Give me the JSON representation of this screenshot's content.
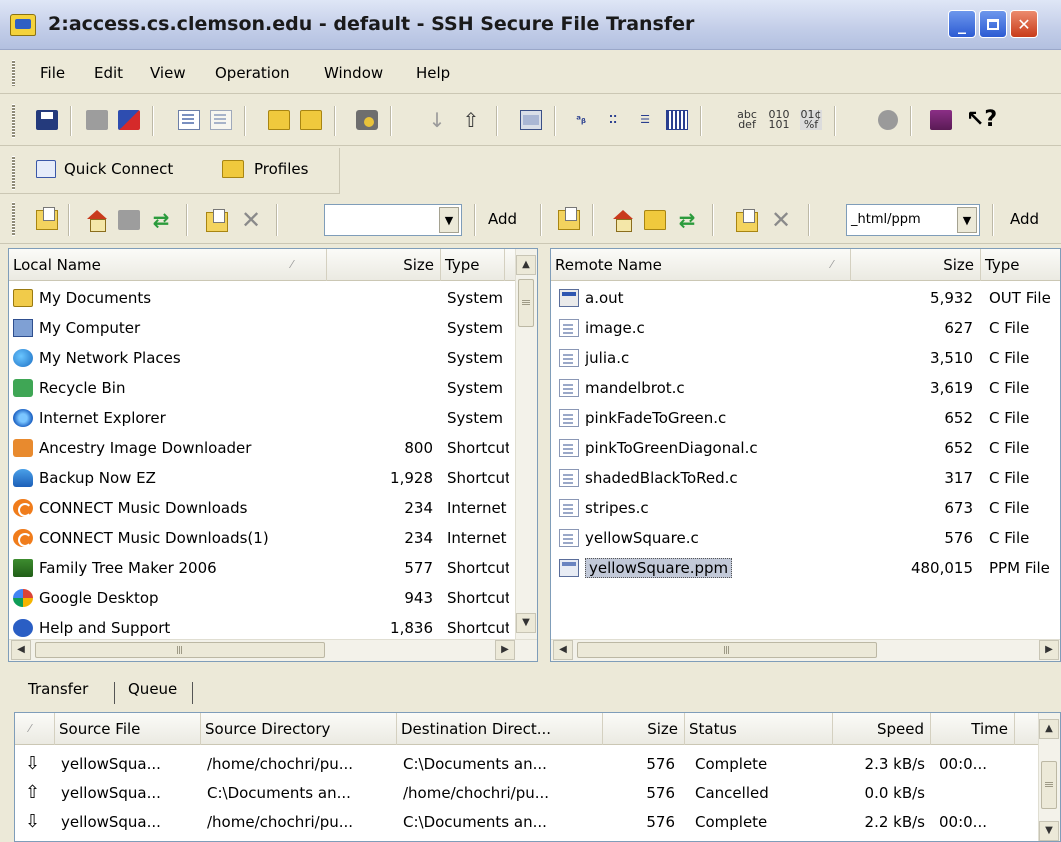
{
  "window": {
    "title": "2:access.cs.clemson.edu - default - SSH Secure File Transfer",
    "minimize": "_",
    "close": "✕"
  },
  "menu": [
    "File",
    "Edit",
    "View",
    "Operation",
    "Window",
    "Help"
  ],
  "toolbar_icons": {
    "tb1": [
      "save-icon",
      "disabled-icon",
      "disconnect-icon",
      "copy-icon",
      "paste-icon",
      "new-terminal-icon",
      "new-file-transfer-icon",
      "settings-icon",
      "download-icon",
      "upload-icon",
      "show-log-icon",
      "large-icons-icon",
      "small-icons-icon",
      "list-icon",
      "details-icon",
      "ascii-icon",
      "binary-icon",
      "auto-mode-icon",
      "stop-icon",
      "help-book-icon",
      "whats-this-icon"
    ],
    "tb3": [
      "up-folder-icon",
      "home-icon",
      "new-folder-icon",
      "refresh-icon",
      "new-file-icon",
      "delete-icon"
    ]
  },
  "quick": {
    "connect_label": "Quick Connect",
    "profiles_label": "Profiles"
  },
  "local_bar": {
    "path_value": "",
    "add_label": "Add"
  },
  "remote_bar": {
    "path_value": "_html/ppm",
    "add_label": "Add"
  },
  "local": {
    "headers": {
      "name": "Local Name",
      "size": "Size",
      "type": "Type"
    },
    "rows": [
      {
        "icon": "my-documents-icon",
        "name": "My Documents",
        "size": "",
        "type": "System"
      },
      {
        "icon": "my-computer-icon",
        "name": "My Computer",
        "size": "",
        "type": "System"
      },
      {
        "icon": "network-places-icon",
        "name": "My Network Places",
        "size": "",
        "type": "System"
      },
      {
        "icon": "recycle-bin-icon",
        "name": "Recycle Bin",
        "size": "",
        "type": "System"
      },
      {
        "icon": "internet-explorer-icon",
        "name": "Internet Explorer",
        "size": "",
        "type": "System"
      },
      {
        "icon": "ancestry-icon",
        "name": "Ancestry Image Downloader",
        "size": "800",
        "type": "Shortcut"
      },
      {
        "icon": "backup-icon",
        "name": "Backup Now EZ",
        "size": "1,928",
        "type": "Shortcut"
      },
      {
        "icon": "connect-music-icon",
        "name": "CONNECT Music Downloads",
        "size": "234",
        "type": "Internet"
      },
      {
        "icon": "connect-music-icon",
        "name": "CONNECT Music Downloads(1)",
        "size": "234",
        "type": "Internet"
      },
      {
        "icon": "family-tree-icon",
        "name": "Family Tree Maker 2006",
        "size": "577",
        "type": "Shortcut"
      },
      {
        "icon": "google-desktop-icon",
        "name": "Google Desktop",
        "size": "943",
        "type": "Shortcut"
      },
      {
        "icon": "help-support-icon",
        "name": "Help and Support",
        "size": "1,836",
        "type": "Shortcut"
      }
    ]
  },
  "remote": {
    "headers": {
      "name": "Remote Name",
      "size": "Size",
      "type": "Type"
    },
    "rows": [
      {
        "icon": "executable-file-icon",
        "name": "a.out",
        "size": "5,932",
        "type": "OUT File"
      },
      {
        "icon": "c-file-icon",
        "name": "image.c",
        "size": "627",
        "type": "C File"
      },
      {
        "icon": "c-file-icon",
        "name": "julia.c",
        "size": "3,510",
        "type": "C File"
      },
      {
        "icon": "c-file-icon",
        "name": "mandelbrot.c",
        "size": "3,619",
        "type": "C File"
      },
      {
        "icon": "c-file-icon",
        "name": "pinkFadeToGreen.c",
        "size": "652",
        "type": "C File"
      },
      {
        "icon": "c-file-icon",
        "name": "pinkToGreenDiagonal.c",
        "size": "652",
        "type": "C File"
      },
      {
        "icon": "c-file-icon",
        "name": "shadedBlackToRed.c",
        "size": "317",
        "type": "C File"
      },
      {
        "icon": "c-file-icon",
        "name": "stripes.c",
        "size": "673",
        "type": "C File"
      },
      {
        "icon": "c-file-icon",
        "name": "yellowSquare.c",
        "size": "576",
        "type": "C File"
      },
      {
        "icon": "ppm-file-icon",
        "name": "yellowSquare.ppm",
        "size": "480,015",
        "type": "PPM File",
        "selected": true
      }
    ]
  },
  "transfer": {
    "tabs": [
      "Transfer",
      "Queue"
    ],
    "headers": {
      "source_file": "Source File",
      "source_dir": "Source Directory",
      "dest_dir": "Destination Direct...",
      "size": "Size",
      "status": "Status",
      "speed": "Speed",
      "time": "Time"
    },
    "rows": [
      {
        "direction": "download-arrow-icon",
        "arrow": "⇩",
        "source_file": "yellowSqua...",
        "source_dir": "/home/chochri/pu...",
        "dest_dir": "C:\\Documents an...",
        "size": "576",
        "status": "Complete",
        "speed": "2.3 kB/s",
        "time": "00:0..."
      },
      {
        "direction": "upload-arrow-icon",
        "arrow": "⇧",
        "source_file": "yellowSqua...",
        "source_dir": "C:\\Documents an...",
        "dest_dir": "/home/chochri/pu...",
        "size": "576",
        "status": "Cancelled",
        "speed": "0.0 kB/s",
        "time": ""
      },
      {
        "direction": "download-arrow-icon",
        "arrow": "⇩",
        "source_file": "yellowSqua...",
        "source_dir": "/home/chochri/pu...",
        "dest_dir": "C:\\Documents an...",
        "size": "576",
        "status": "Complete",
        "speed": "2.2 kB/s",
        "time": "00:0..."
      }
    ]
  }
}
